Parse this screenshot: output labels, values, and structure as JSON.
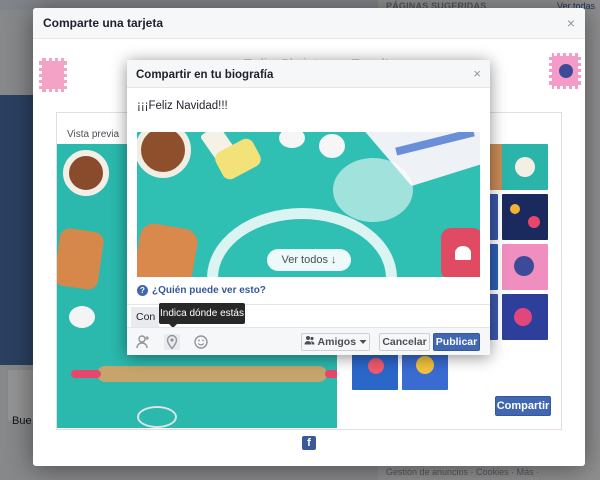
{
  "background": {
    "suggested_pages_title": "PÁGINAS SUGERIDAS",
    "see_all_link": "Ver todas",
    "post_snippet": "Bue",
    "footer_links": "Gestión de anuncios · Cookies · Más ·"
  },
  "outer_dialog": {
    "title": "Comparte una tarjeta",
    "close_symbol": "×",
    "faded_greeting": "Feliz Christmas Feed!",
    "preview_label": "Vista previa",
    "share_button": "Compartir",
    "facebook_logo": "f"
  },
  "inner_dialog": {
    "title": "Compartir en tu biografía",
    "close_symbol": "×",
    "message": "¡¡¡Feliz Navidad!!!",
    "see_all_overlay": "Ver todos ↓",
    "who_can_see_icon": "?",
    "who_can_see_link": "¿Quién puede ver esto?",
    "with_field_label": "Con",
    "location_tooltip": "Indica dónde estás",
    "audience_button": "Amigos",
    "cancel_button": "Cancelar",
    "publish_button": "Publicar"
  },
  "colors": {
    "brand_blue": "#4267b2",
    "card_teal": "#2fbfb3",
    "tooltip_dark": "#282828"
  },
  "icons": {
    "tag_friends": "person-tag-icon",
    "location": "location-pin-icon",
    "feeling": "smiley-icon",
    "audience": "friends-icon",
    "dropdown": "caret-down-icon"
  }
}
